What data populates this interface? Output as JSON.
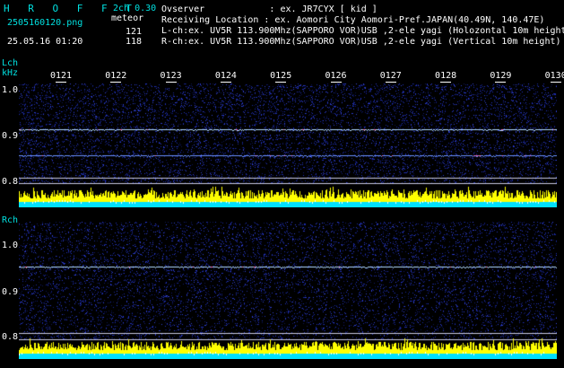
{
  "header": {
    "app_title": "H R O F F T",
    "mode": "2ch 0.30",
    "filename": "2505160120.png",
    "detection_type": "meteor",
    "timestamp": "25.05.16 01:20",
    "lch_count": "121",
    "rch_count": "118",
    "observer_line": "Ovserver            : ex. JR7CYX [ kid ]",
    "location_line": "Receiving Location : ex. Aomori City Aomori-Pref.JAPAN(40.49N, 140.47E)",
    "lch_line": "L-ch:ex. UV5R 113.900Mhz(SAPPORO VOR)USB ,2-ele yagi (Holozontal 10m height)",
    "rch_line": "R-ch:ex. UV5R 113.900Mhz(SAPPORO VOR)USB ,2-ele yagi (Vertical 10m height)"
  },
  "lch": {
    "channel_label": "Lch",
    "unit_label": "kHz",
    "y_labels": [
      "1.0",
      "0.9",
      "0.8"
    ]
  },
  "rch": {
    "channel_label": "Rch",
    "y_labels": [
      "1.0",
      "0.9",
      "0.8"
    ]
  },
  "time_ticks": [
    "0121",
    "0122",
    "0123",
    "0124",
    "0125",
    "0126",
    "0127",
    "0128",
    "0129",
    "0130"
  ],
  "colors": {
    "text_cyan": "#00e0e0",
    "noise_blue": "#1a2aa0",
    "signal_line": "#9fd0ff",
    "level_yellow": "#ffff00",
    "level_cyan": "#00e0ff",
    "guide_line": "#c8c8e0"
  }
}
